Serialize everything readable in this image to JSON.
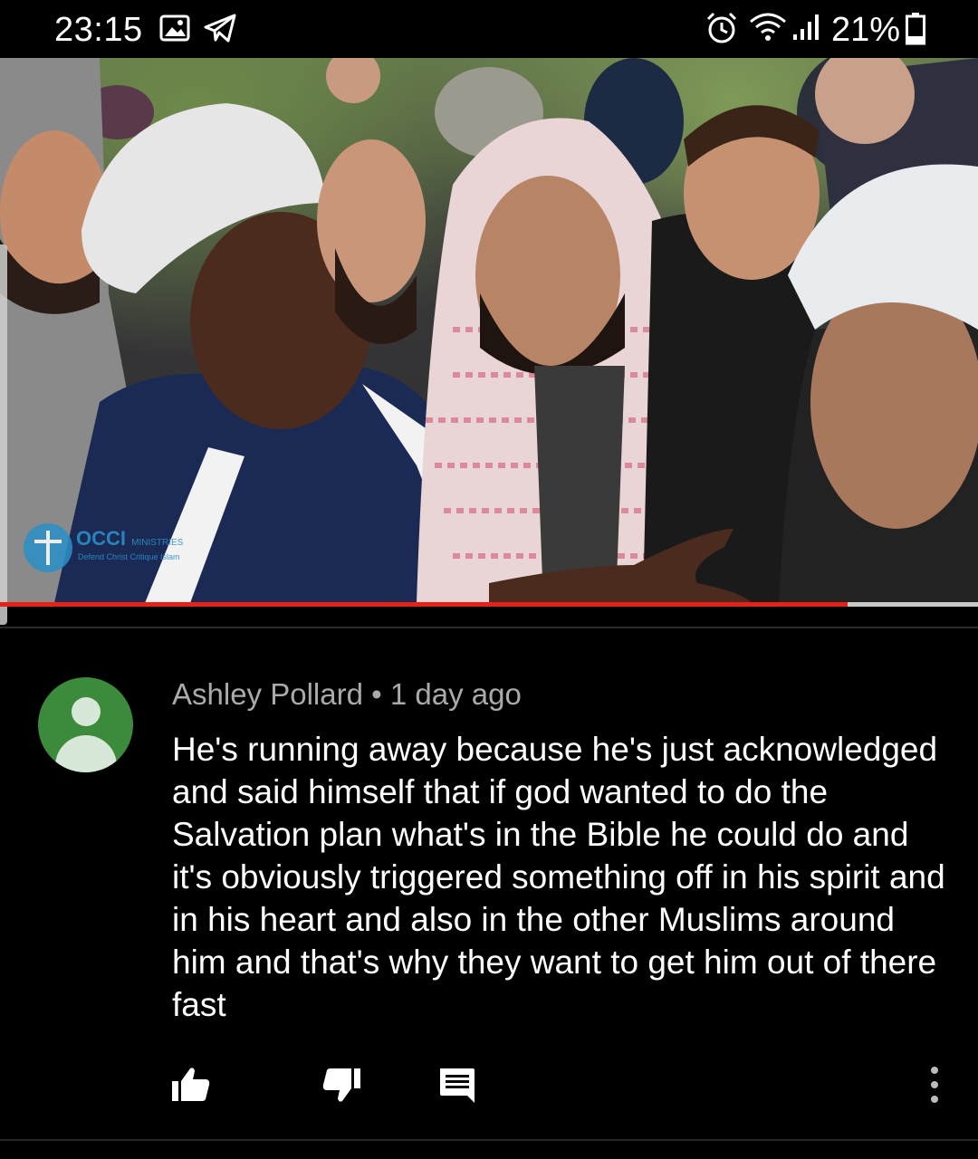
{
  "status_bar": {
    "time": "23:15",
    "battery_percent": "21%",
    "icons": [
      "gallery-icon",
      "telegram-icon",
      "alarm-icon",
      "wifi-icon",
      "signal-icon",
      "battery-icon"
    ]
  },
  "video": {
    "watermark_main": "OCCI",
    "watermark_small": "MINISTRIES",
    "watermark_sub": "Defend Christ Critique Islam",
    "progress_fraction": 0.867,
    "colors": {
      "progress": "#e62117",
      "track": "#c8c8c8"
    }
  },
  "comment": {
    "author": "Ashley Pollard",
    "separator": "•",
    "time_ago": "1 day ago",
    "text": "He's running away because he's just acknowledged and said himself that if god wanted to do the Salvation plan what's in the Bible he could do and it's obviously triggered something off in his spirit and in his heart and also in the other Muslims around him and that's why they want to get him out of there fast",
    "avatar_color": "#3c8a3c",
    "actions": [
      "like-icon",
      "dislike-icon",
      "reply-icon",
      "more-options-icon"
    ]
  }
}
